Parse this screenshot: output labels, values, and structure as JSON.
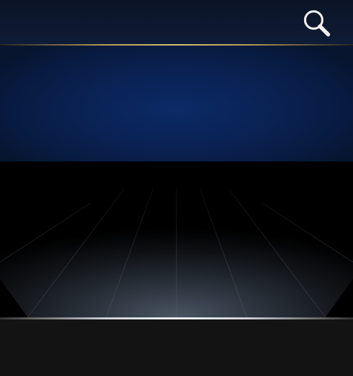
{
  "header": {
    "search_icon": "search-icon"
  },
  "colors": {
    "header_bg": "#0b1426",
    "gold_accent": "#d8c777",
    "banner_blue": "#0c2a66",
    "stage_floor": "#3a4452",
    "tray_bg": "#131313"
  }
}
